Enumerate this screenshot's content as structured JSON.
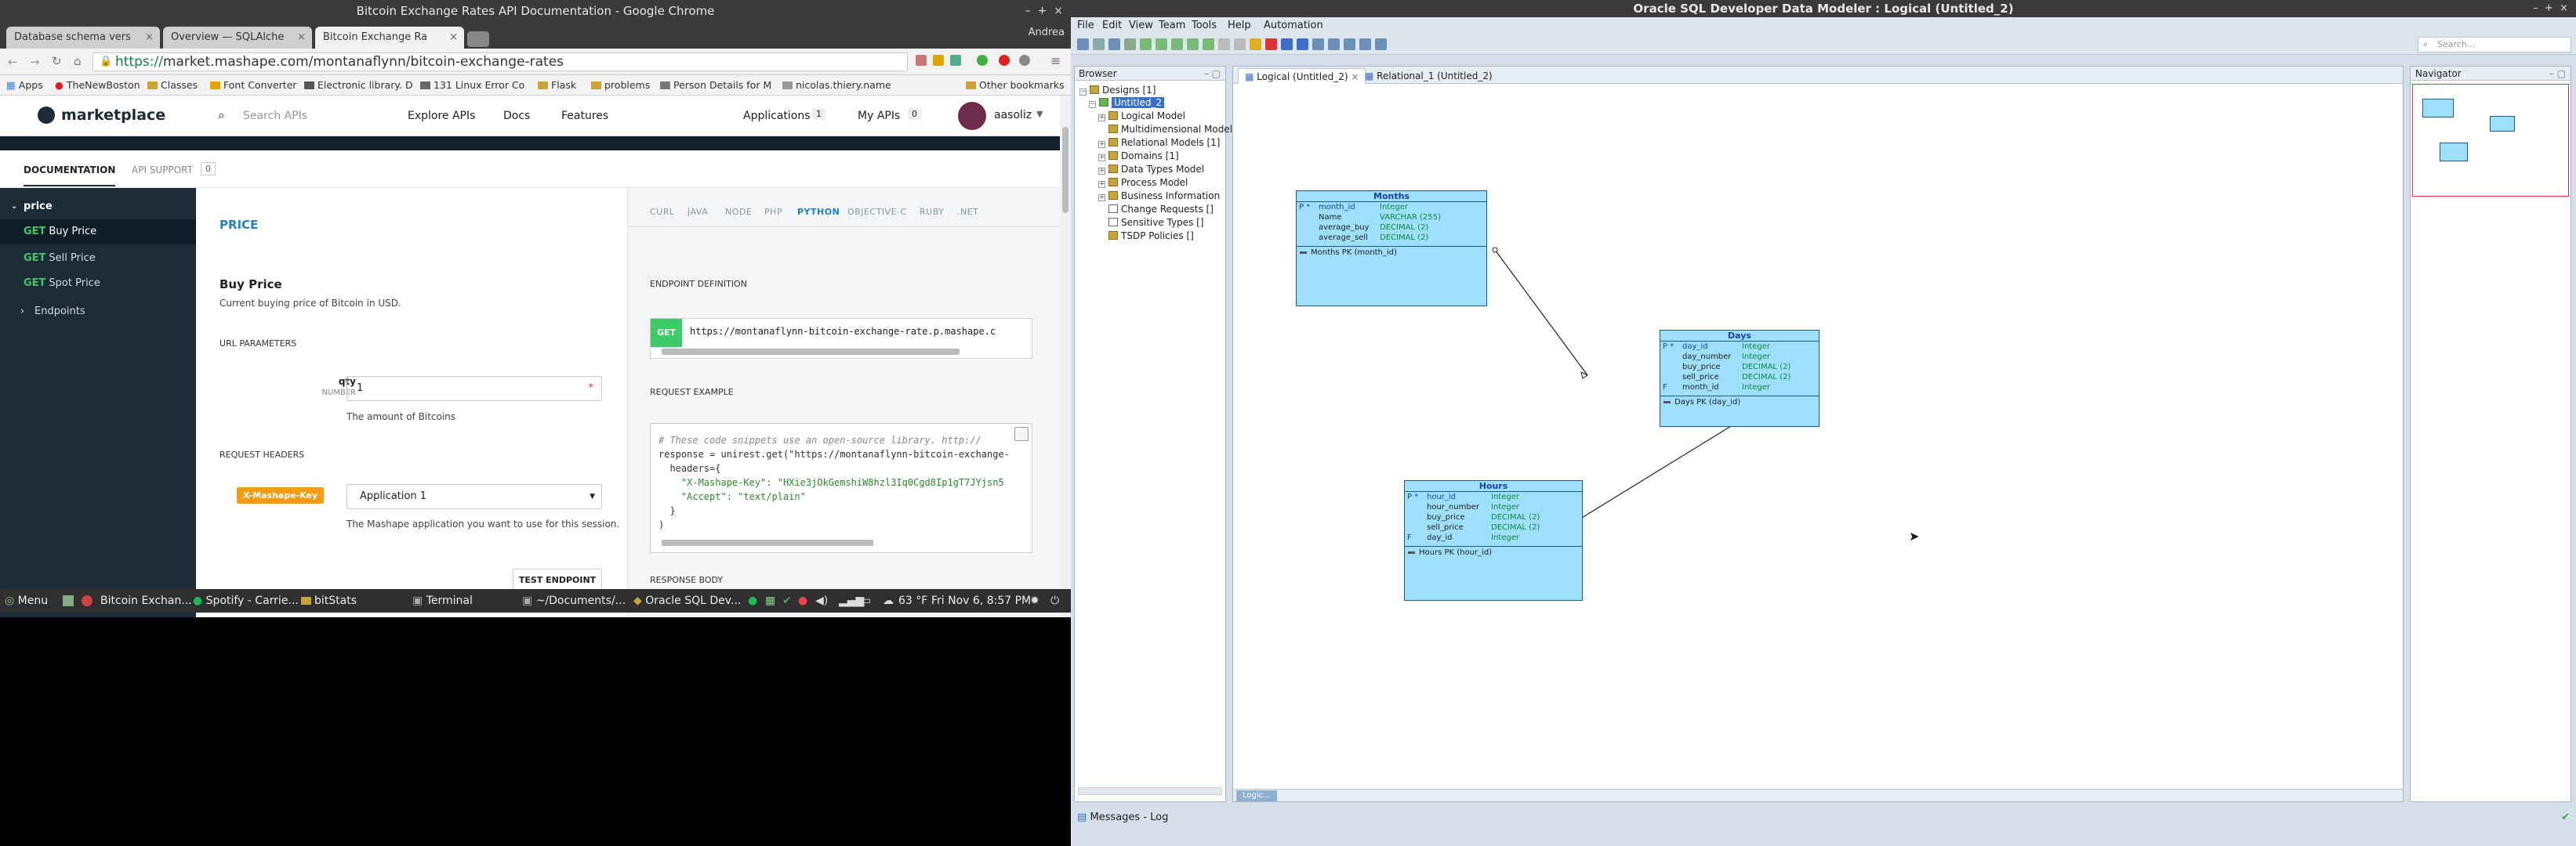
{
  "chrome": {
    "title": "Bitcoin Exchange Rates API Documentation - Google Chrome",
    "user": "Andrea",
    "tabs": [
      {
        "label": "Database schema vers"
      },
      {
        "label": "Overview — SQLAlche"
      },
      {
        "label": "Bitcoin Exchange Ra"
      }
    ],
    "url_scheme": "https://",
    "url_rest": "market.mashape.com/montanaflynn/bitcoin-exchange-rates",
    "bookmarks": [
      "Apps",
      "TheNewBoston",
      "Classes",
      "Font Converter",
      "Electronic library. D",
      "131 Linux Error Co",
      "Flask",
      "problems",
      "Person Details for M",
      "nicolas.thiery.name",
      "Other bookmarks"
    ]
  },
  "mashape": {
    "logo": "marketplace",
    "search_placeholder": "Search APIs",
    "nav": [
      "Explore APIs",
      "Docs",
      "Features"
    ],
    "applications": "Applications",
    "applications_count": "1",
    "my_apis": "My APIs",
    "my_apis_count": "0",
    "username": "aasoliz",
    "doc_tab": "DOCUMENTATION",
    "support_tab": "API SUPPORT",
    "support_count": "0",
    "sidebar": {
      "group": "price",
      "items": [
        {
          "method": "GET",
          "label": "Buy Price"
        },
        {
          "method": "GET",
          "label": "Sell Price"
        },
        {
          "method": "GET",
          "label": "Spot Price"
        }
      ],
      "endpoints": "Endpoints"
    },
    "section_title": "PRICE",
    "endpoint_title": "Buy Price",
    "endpoint_desc": "Current buying price of Bitcoin in USD.",
    "url_params": "URL PARAMETERS",
    "param_name": "qty",
    "param_type": "NUMBER",
    "param_value": "1",
    "param_desc": "The amount of Bitcoins",
    "request_headers": "REQUEST HEADERS",
    "header_key": "X-Mashape-Key",
    "header_value": "Application 1",
    "header_desc": "The Mashape application you want to use for this session.",
    "test_button": "TEST ENDPOINT",
    "languages": [
      "CURL",
      "JAVA",
      "NODE",
      "PHP",
      "PYTHON",
      "OBJECTIVE-C",
      "RUBY",
      ".NET"
    ],
    "endpoint_definition": "ENDPOINT DEFINITION",
    "endpoint_method": "GET",
    "endpoint_url": "https://montanaflynn-bitcoin-exchange-rate.p.mashape.c",
    "request_example": "REQUEST EXAMPLE",
    "code_lines": [
      "# These code snippets use an open-source library. http://",
      "response = unirest.get(\"https://montanaflynn-bitcoin-exchange-",
      "  headers={",
      "    \"X-Mashape-Key\": \"HXie3jOkGemshiW8hzl3Iq0Cgd8Ip1gT7JYjsn5",
      "    \"Accept\": \"text/plain\"",
      "  }",
      ")"
    ],
    "response_body": "RESPONSE BODY"
  },
  "taskbar": {
    "menu": "Menu",
    "items": [
      "Bitcoin Exchan...",
      "Spotify - Carrie...",
      "bitStats",
      "Terminal",
      "~/Documents/...",
      "Oracle SQL Dev..."
    ],
    "weather": "63 °F",
    "datetime": "Fri Nov  6,  8:57 PM"
  },
  "oracle": {
    "title": "Oracle SQL Developer Data Modeler : Logical (Untitled_2)",
    "menu": [
      "File",
      "Edit",
      "View",
      "Team",
      "Tools",
      "Help",
      "Automation"
    ],
    "search_placeholder": "Search...",
    "browser_title": "Browser",
    "tree": [
      {
        "label": "Designs [1]",
        "level": 0
      },
      {
        "label": "Untitled_2",
        "level": 1
      },
      {
        "label": "Logical Model",
        "level": 2
      },
      {
        "label": "Multidimensional Model",
        "level": 2
      },
      {
        "label": "Relational Models [1]",
        "level": 2
      },
      {
        "label": "Domains [1]",
        "level": 2
      },
      {
        "label": "Data Types Model",
        "level": 2
      },
      {
        "label": "Process Model",
        "level": 2
      },
      {
        "label": "Business Information",
        "level": 2
      },
      {
        "label": "Change Requests []",
        "level": 2
      },
      {
        "label": "Sensitive Types []",
        "level": 2
      },
      {
        "label": "TSDP Policies []",
        "level": 2
      }
    ],
    "editor_tabs": [
      "Logical (Untitled_2)",
      "Relational_1 (Untitled_2)"
    ],
    "navigator_title": "Navigator",
    "bottom_tab": "Logic...",
    "messages": "Messages - Log",
    "entities": {
      "months": {
        "title": "Months",
        "attrs": [
          {
            "flag": "P *",
            "name": "month_id",
            "type": "Integer"
          },
          {
            "flag": "",
            "name": "Name",
            "type": "VARCHAR (255)"
          },
          {
            "flag": "",
            "name": "average_buy",
            "type": "DECIMAL (2)"
          },
          {
            "flag": "",
            "name": "average_sell",
            "type": "DECIMAL (2)"
          }
        ],
        "pk": "Months PK (month_id)"
      },
      "days": {
        "title": "Days",
        "attrs": [
          {
            "flag": "P *",
            "name": "day_id",
            "type": "Integer"
          },
          {
            "flag": "",
            "name": "day_number",
            "type": "Integer"
          },
          {
            "flag": "",
            "name": "buy_price",
            "type": "DECIMAL (2)"
          },
          {
            "flag": "",
            "name": "sell_price",
            "type": "DECIMAL (2)"
          },
          {
            "flag": "F",
            "name": "month_id",
            "type": "Integer"
          }
        ],
        "pk": "Days PK (day_id)"
      },
      "hours": {
        "title": "Hours",
        "attrs": [
          {
            "flag": "P *",
            "name": "hour_id",
            "type": "Integer"
          },
          {
            "flag": "",
            "name": "hour_number",
            "type": "Integer"
          },
          {
            "flag": "",
            "name": "buy_price",
            "type": "DECIMAL (2)"
          },
          {
            "flag": "",
            "name": "sell_price",
            "type": "DECIMAL (2)"
          },
          {
            "flag": "F",
            "name": "day_id",
            "type": "Integer"
          }
        ],
        "pk": "Hours PK (hour_id)"
      }
    }
  }
}
